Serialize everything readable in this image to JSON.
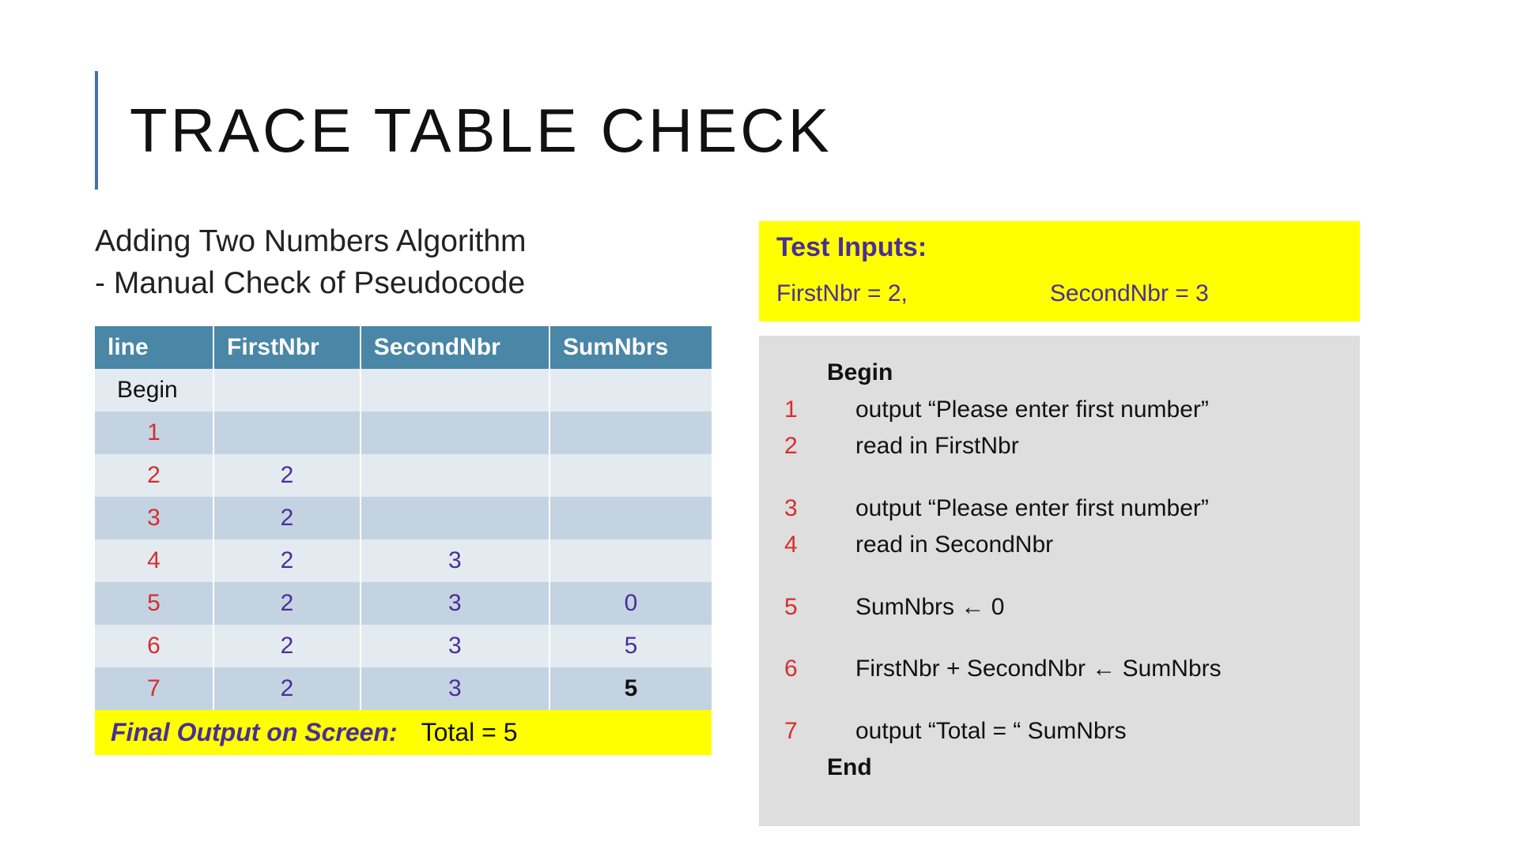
{
  "title": "TRACE TABLE CHECK",
  "subtitle_line1": "Adding Two Numbers Algorithm",
  "subtitle_line2": "- Manual Check of Pseudocode",
  "table": {
    "headers": [
      "line",
      "FirstNbr",
      "SecondNbr",
      "SumNbrs"
    ],
    "rows": [
      {
        "line": "Begin",
        "isBegin": true,
        "c1": "",
        "c2": "",
        "c3": "",
        "shade": "light"
      },
      {
        "line": "1",
        "c1": "",
        "c2": "",
        "c3": "",
        "shade": "dark"
      },
      {
        "line": "2",
        "c1": "2",
        "c2": "",
        "c3": "",
        "shade": "light"
      },
      {
        "line": "3",
        "c1": "2",
        "c2": "",
        "c3": "",
        "shade": "dark"
      },
      {
        "line": "4",
        "c1": "2",
        "c2": "3",
        "c3": "",
        "shade": "light"
      },
      {
        "line": "5",
        "c1": "2",
        "c2": "3",
        "c3": "0",
        "shade": "dark"
      },
      {
        "line": "6",
        "c1": "2",
        "c2": "3",
        "c3": "5",
        "shade": "light"
      },
      {
        "line": "7",
        "c1": "2",
        "c2": "3",
        "c3": "5",
        "c3Bold": true,
        "shade": "dark"
      }
    ]
  },
  "final_label": "Final Output on Screen:",
  "final_value": "Total = 5",
  "test_inputs": {
    "title": "Test Inputs:",
    "first": "FirstNbr = 2,",
    "second": "SecondNbr = 3"
  },
  "code": {
    "begin": "Begin",
    "end": "End",
    "lines": [
      {
        "n": "1",
        "text": "output “Please enter first number”"
      },
      {
        "n": "2",
        "text": "read in FirstNbr"
      },
      {
        "spacer": true
      },
      {
        "n": "3",
        "text": "output “Please enter first number”"
      },
      {
        "n": "4",
        "text": "read in SecondNbr"
      },
      {
        "spacer": true
      },
      {
        "n": "5",
        "text": "SumNbrs ← 0"
      },
      {
        "spacer": true
      },
      {
        "n": "6",
        "text": "FirstNbr + SecondNbr ← SumNbrs"
      },
      {
        "spacer": true
      },
      {
        "n": "7",
        "text": "output “Total = “ SumNbrs"
      }
    ]
  }
}
